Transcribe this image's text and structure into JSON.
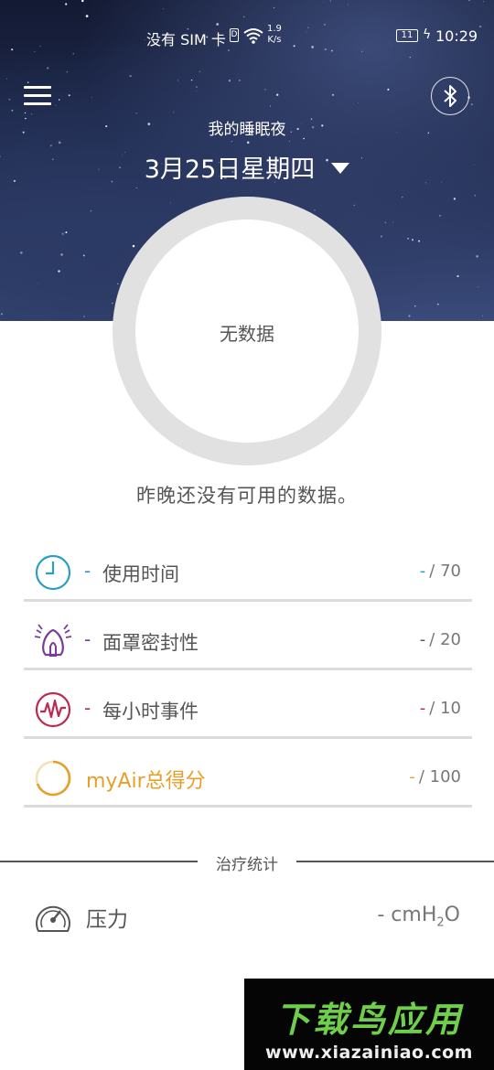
{
  "status_bar": {
    "carrier": "没有 SIM 卡",
    "sim_icon_text": "D",
    "speed_value": "1.9",
    "speed_unit": "K/s",
    "battery": "11",
    "time": "10:29"
  },
  "header": {
    "subtitle": "我的睡眠夜",
    "date": "3月25日星期四"
  },
  "score_ring": {
    "label": "无数据"
  },
  "message": "昨晚还没有可用的数据。",
  "metrics": [
    {
      "icon": "clock-icon",
      "color": "#2a9fbf",
      "dash": "-",
      "label": "使用时间",
      "value_dash": "-",
      "max": "/ 70"
    },
    {
      "icon": "mask-icon",
      "color": "#7a3a9a",
      "dash": "-",
      "label": "面罩密封性",
      "value_dash": "-",
      "max": "/ 20"
    },
    {
      "icon": "events-wave-icon",
      "color": "#c0294e",
      "dash": "-",
      "label": "每小时事件",
      "value_dash": "-",
      "max": "/ 10"
    },
    {
      "icon": "score-ring-icon",
      "color": "#e6a02a",
      "dash": "",
      "label": "myAir总得分",
      "value_dash": "-",
      "max": "/ 100"
    }
  ],
  "therapy": {
    "section_title": "治疗统计",
    "pressure_label": "压力",
    "pressure_value": "- cmH",
    "pressure_sub": "2",
    "pressure_tail": "O"
  },
  "watermark": {
    "title": "下载鸟应用",
    "url": "www.xiazainiao.com"
  }
}
